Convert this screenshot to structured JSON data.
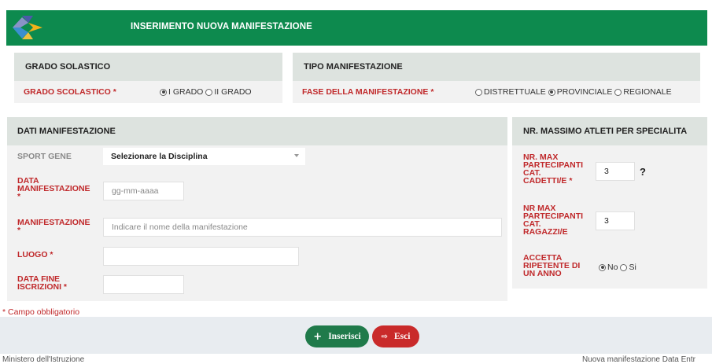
{
  "header": {
    "title": "INSERIMENTO NUOVA MANIFESTAZIONE"
  },
  "grado": {
    "heading": "GRADO SOLASTICO",
    "label": "GRADO SCOLASTICO *",
    "options": [
      "I GRADO",
      "II GRADO"
    ],
    "selected": "I GRADO"
  },
  "tipo": {
    "heading": "TIPO MANIFESTAZIONE",
    "label": "FASE DELLA MANIFESTAZIONE *",
    "options": [
      "DISTRETTUALE",
      "PROVINCIALE",
      "REGIONALE"
    ],
    "selected": "PROVINCIALE"
  },
  "dati": {
    "heading": "DATI MANIFESTAZIONE",
    "sport_label": "SPORT GENE",
    "sport_value": "Selezionare la Disciplina",
    "data_label_1": "DATA",
    "data_label_2": "MANIFESTAZIONE",
    "data_label_3": "*",
    "data_placeholder": "gg-mm-aaaa",
    "manif_label_1": "MANIFESTAZIONE",
    "manif_label_2": "*",
    "manif_placeholder": "Indicare il nome della manifestazione",
    "luogo_label": "LUOGO *",
    "fine_label_1": "DATA FINE",
    "fine_label_2": "ISCRIZIONI *"
  },
  "atleti": {
    "heading": "NR. MASSIMO ATLETI PER SPECIALITA",
    "cadetti_label": [
      "NR. MAX",
      "PARTECIPANTI",
      "CAT.",
      "CADETTI/E *"
    ],
    "cadetti_value": "3",
    "help": "?",
    "ragazzi_label": [
      "NR MAX",
      "PARTECIPANTI",
      "CAT.",
      "RAGAZZI/E"
    ],
    "ragazzi_value": "3",
    "ripetente_label": [
      "ACCETTA",
      "RIPETENTE DI",
      "UN ANNO"
    ],
    "ripetente_options": [
      "No",
      "Si"
    ],
    "ripetente_selected": "No"
  },
  "required_note": "* Campo obbligatorio",
  "buttons": {
    "insert": "Inserisci",
    "exit": "Esci"
  },
  "footer": {
    "left": "Ministero dell'Istruzione",
    "right": "Nuova manifestazione Data Entr"
  },
  "colors": {
    "header": "#0d8a4e",
    "required": "#c0292b",
    "insert": "#1f7a4a",
    "exit": "#c92a2a"
  }
}
